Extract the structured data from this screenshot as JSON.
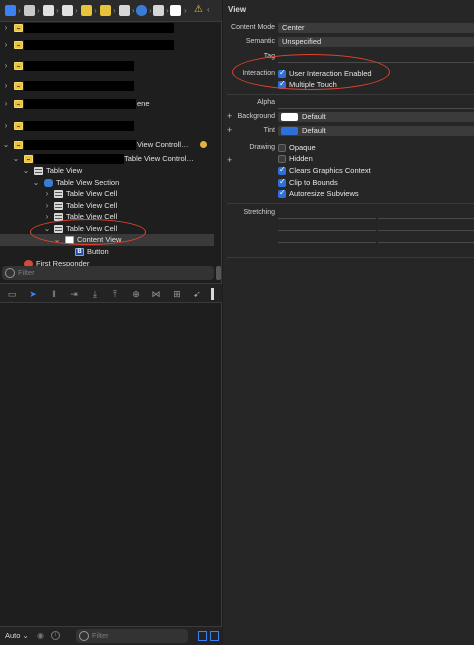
{
  "outline": {
    "rows": [
      {
        "label": "",
        "redacted": true
      },
      {
        "label": "",
        "redacted": true
      },
      {
        "label": "",
        "redacted": true
      },
      {
        "label": "",
        "redacted": true
      },
      {
        "label": "ene",
        "redacted": true
      },
      {
        "label": "",
        "redacted": true
      },
      {
        "label": "View Controll…",
        "redacted": true
      },
      {
        "label": "Table View Control…",
        "redacted": true
      },
      {
        "label": "Table View"
      },
      {
        "label": "Table View Section"
      },
      {
        "label": "Table View Cell"
      },
      {
        "label": "Table View Cell"
      },
      {
        "label": "Table View Cell"
      },
      {
        "label": "Table View Cell"
      },
      {
        "label": "Content View"
      },
      {
        "label": "Button"
      },
      {
        "label": "First Responder"
      }
    ],
    "filter_placeholder": "Filter"
  },
  "bottom": {
    "auto_label": "Auto ⌄",
    "filter_placeholder": "Filter"
  },
  "inspector": {
    "section_title": "View",
    "content_mode_label": "Content Mode",
    "content_mode_value": "Center",
    "semantic_label": "Semantic",
    "semantic_value": "Unspecified",
    "tag_label": "Tag",
    "interaction_label": "Interaction",
    "user_interaction_enabled": "User Interaction Enabled",
    "multiple_touch": "Multiple Touch",
    "alpha_label": "Alpha",
    "background_label": "Background",
    "background_value": "Default",
    "tint_label": "Tint",
    "tint_value": "Default",
    "drawing_label": "Drawing",
    "opaque": "Opaque",
    "hidden": "Hidden",
    "clears_graphics_context": "Clears Graphics Context",
    "clip_to_bounds": "Clip to Bounds",
    "autoresize_subviews": "Autoresize Subviews",
    "stretching_label": "Stretching",
    "checkbox_states": {
      "user_interaction_enabled": true,
      "multiple_touch": true,
      "opaque": false,
      "hidden": false,
      "clears_graphics_context": true,
      "clip_to_bounds": true,
      "autoresize_subviews": true
    }
  },
  "colors": {
    "accent": "#2f6fd8",
    "annotation": "#e0432f",
    "tint_swatch": "#2f6fd8",
    "background_swatch": "#ffffff"
  },
  "icons": [
    "grid-icon",
    "folder-icon",
    "file-icon",
    "storyboard-icon",
    "scene-icon",
    "tableview-icon",
    "cube-icon",
    "warning-icon"
  ]
}
